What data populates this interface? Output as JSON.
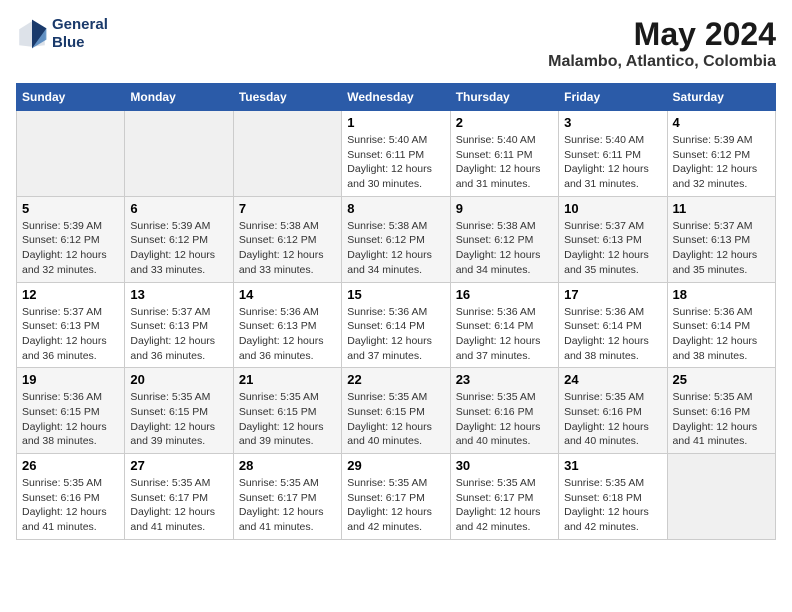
{
  "header": {
    "logo_line1": "General",
    "logo_line2": "Blue",
    "main_title": "May 2024",
    "subtitle": "Malambo, Atlantico, Colombia"
  },
  "days_of_week": [
    "Sunday",
    "Monday",
    "Tuesday",
    "Wednesday",
    "Thursday",
    "Friday",
    "Saturday"
  ],
  "weeks": [
    [
      {
        "day": "",
        "info": ""
      },
      {
        "day": "",
        "info": ""
      },
      {
        "day": "",
        "info": ""
      },
      {
        "day": "1",
        "info": "Sunrise: 5:40 AM\nSunset: 6:11 PM\nDaylight: 12 hours\nand 30 minutes."
      },
      {
        "day": "2",
        "info": "Sunrise: 5:40 AM\nSunset: 6:11 PM\nDaylight: 12 hours\nand 31 minutes."
      },
      {
        "day": "3",
        "info": "Sunrise: 5:40 AM\nSunset: 6:11 PM\nDaylight: 12 hours\nand 31 minutes."
      },
      {
        "day": "4",
        "info": "Sunrise: 5:39 AM\nSunset: 6:12 PM\nDaylight: 12 hours\nand 32 minutes."
      }
    ],
    [
      {
        "day": "5",
        "info": "Sunrise: 5:39 AM\nSunset: 6:12 PM\nDaylight: 12 hours\nand 32 minutes."
      },
      {
        "day": "6",
        "info": "Sunrise: 5:39 AM\nSunset: 6:12 PM\nDaylight: 12 hours\nand 33 minutes."
      },
      {
        "day": "7",
        "info": "Sunrise: 5:38 AM\nSunset: 6:12 PM\nDaylight: 12 hours\nand 33 minutes."
      },
      {
        "day": "8",
        "info": "Sunrise: 5:38 AM\nSunset: 6:12 PM\nDaylight: 12 hours\nand 34 minutes."
      },
      {
        "day": "9",
        "info": "Sunrise: 5:38 AM\nSunset: 6:12 PM\nDaylight: 12 hours\nand 34 minutes."
      },
      {
        "day": "10",
        "info": "Sunrise: 5:37 AM\nSunset: 6:13 PM\nDaylight: 12 hours\nand 35 minutes."
      },
      {
        "day": "11",
        "info": "Sunrise: 5:37 AM\nSunset: 6:13 PM\nDaylight: 12 hours\nand 35 minutes."
      }
    ],
    [
      {
        "day": "12",
        "info": "Sunrise: 5:37 AM\nSunset: 6:13 PM\nDaylight: 12 hours\nand 36 minutes."
      },
      {
        "day": "13",
        "info": "Sunrise: 5:37 AM\nSunset: 6:13 PM\nDaylight: 12 hours\nand 36 minutes."
      },
      {
        "day": "14",
        "info": "Sunrise: 5:36 AM\nSunset: 6:13 PM\nDaylight: 12 hours\nand 36 minutes."
      },
      {
        "day": "15",
        "info": "Sunrise: 5:36 AM\nSunset: 6:14 PM\nDaylight: 12 hours\nand 37 minutes."
      },
      {
        "day": "16",
        "info": "Sunrise: 5:36 AM\nSunset: 6:14 PM\nDaylight: 12 hours\nand 37 minutes."
      },
      {
        "day": "17",
        "info": "Sunrise: 5:36 AM\nSunset: 6:14 PM\nDaylight: 12 hours\nand 38 minutes."
      },
      {
        "day": "18",
        "info": "Sunrise: 5:36 AM\nSunset: 6:14 PM\nDaylight: 12 hours\nand 38 minutes."
      }
    ],
    [
      {
        "day": "19",
        "info": "Sunrise: 5:36 AM\nSunset: 6:15 PM\nDaylight: 12 hours\nand 38 minutes."
      },
      {
        "day": "20",
        "info": "Sunrise: 5:35 AM\nSunset: 6:15 PM\nDaylight: 12 hours\nand 39 minutes."
      },
      {
        "day": "21",
        "info": "Sunrise: 5:35 AM\nSunset: 6:15 PM\nDaylight: 12 hours\nand 39 minutes."
      },
      {
        "day": "22",
        "info": "Sunrise: 5:35 AM\nSunset: 6:15 PM\nDaylight: 12 hours\nand 40 minutes."
      },
      {
        "day": "23",
        "info": "Sunrise: 5:35 AM\nSunset: 6:16 PM\nDaylight: 12 hours\nand 40 minutes."
      },
      {
        "day": "24",
        "info": "Sunrise: 5:35 AM\nSunset: 6:16 PM\nDaylight: 12 hours\nand 40 minutes."
      },
      {
        "day": "25",
        "info": "Sunrise: 5:35 AM\nSunset: 6:16 PM\nDaylight: 12 hours\nand 41 minutes."
      }
    ],
    [
      {
        "day": "26",
        "info": "Sunrise: 5:35 AM\nSunset: 6:16 PM\nDaylight: 12 hours\nand 41 minutes."
      },
      {
        "day": "27",
        "info": "Sunrise: 5:35 AM\nSunset: 6:17 PM\nDaylight: 12 hours\nand 41 minutes."
      },
      {
        "day": "28",
        "info": "Sunrise: 5:35 AM\nSunset: 6:17 PM\nDaylight: 12 hours\nand 41 minutes."
      },
      {
        "day": "29",
        "info": "Sunrise: 5:35 AM\nSunset: 6:17 PM\nDaylight: 12 hours\nand 42 minutes."
      },
      {
        "day": "30",
        "info": "Sunrise: 5:35 AM\nSunset: 6:17 PM\nDaylight: 12 hours\nand 42 minutes."
      },
      {
        "day": "31",
        "info": "Sunrise: 5:35 AM\nSunset: 6:18 PM\nDaylight: 12 hours\nand 42 minutes."
      },
      {
        "day": "",
        "info": ""
      }
    ]
  ],
  "colors": {
    "header_bg": "#2b5ba8",
    "header_text": "#ffffff",
    "empty_cell_bg": "#f0f0f0",
    "even_row_bg": "#f5f5f5",
    "odd_row_bg": "#ffffff"
  }
}
